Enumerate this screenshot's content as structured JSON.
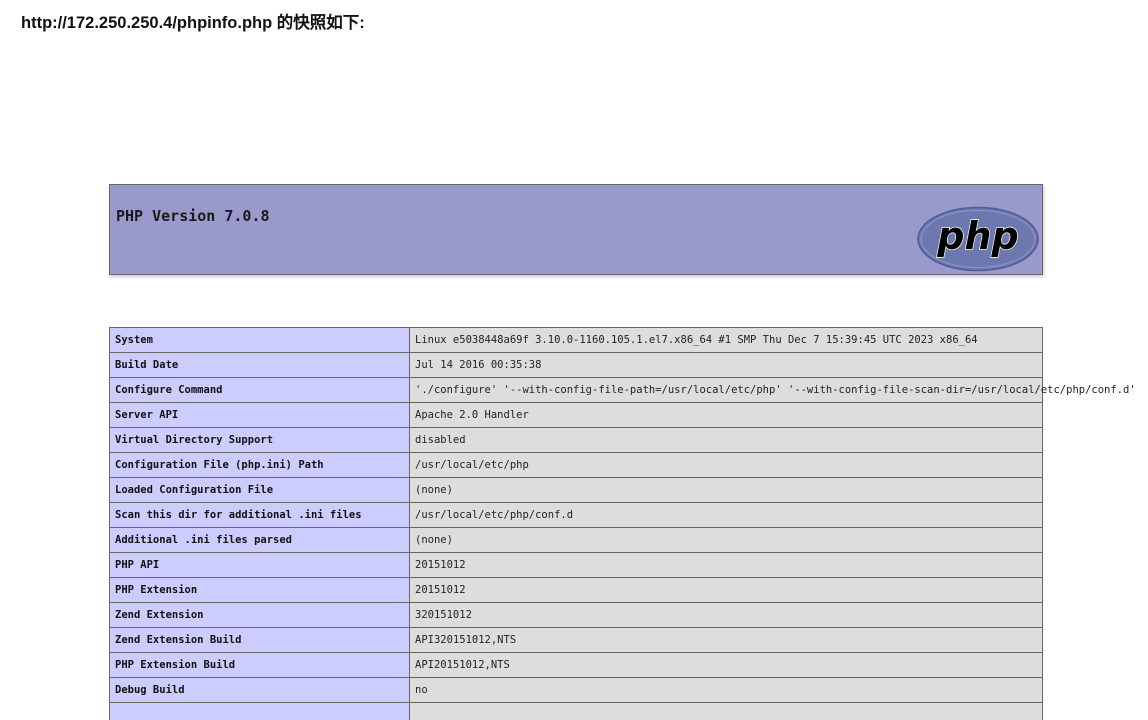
{
  "snapshot": {
    "heading": "http://172.250.250.4/phpinfo.php 的快照如下:"
  },
  "php_header": {
    "version_title": "PHP Version 7.0.8",
    "logo_text": "php"
  },
  "info_rows": [
    {
      "label": "System",
      "value": "Linux e5038448a69f 3.10.0-1160.105.1.el7.x86_64 #1 SMP Thu Dec 7 15:39:45 UTC 2023 x86_64"
    },
    {
      "label": "Build Date",
      "value": "Jul 14 2016 00:35:38"
    },
    {
      "label": "Configure Command",
      "value": " './configure'  '--with-config-file-path=/usr/local/etc/php' '--with-config-file-scan-dir=/usr/local/etc/php/conf.d'"
    },
    {
      "label": "Server API",
      "value": "Apache 2.0 Handler"
    },
    {
      "label": "Virtual Directory Support",
      "value": "disabled"
    },
    {
      "label": "Configuration File (php.ini) Path",
      "value": "/usr/local/etc/php"
    },
    {
      "label": "Loaded Configuration File",
      "value": "(none)"
    },
    {
      "label": "Scan this dir for additional .ini files",
      "value": "/usr/local/etc/php/conf.d"
    },
    {
      "label": "Additional .ini files parsed",
      "value": "(none)"
    },
    {
      "label": "PHP API",
      "value": "20151012"
    },
    {
      "label": "PHP Extension",
      "value": "20151012"
    },
    {
      "label": "Zend Extension",
      "value": "320151012"
    },
    {
      "label": "Zend Extension Build",
      "value": "API320151012,NTS"
    },
    {
      "label": "PHP Extension Build",
      "value": "API20151012,NTS"
    },
    {
      "label": "Debug Build",
      "value": "no"
    },
    {
      "label": "",
      "value": ""
    }
  ],
  "colors": {
    "header_bg": "#9999cc",
    "label_bg": "#ccccff",
    "value_bg": "#dddddd",
    "logo_fill": "#6c78ae"
  }
}
